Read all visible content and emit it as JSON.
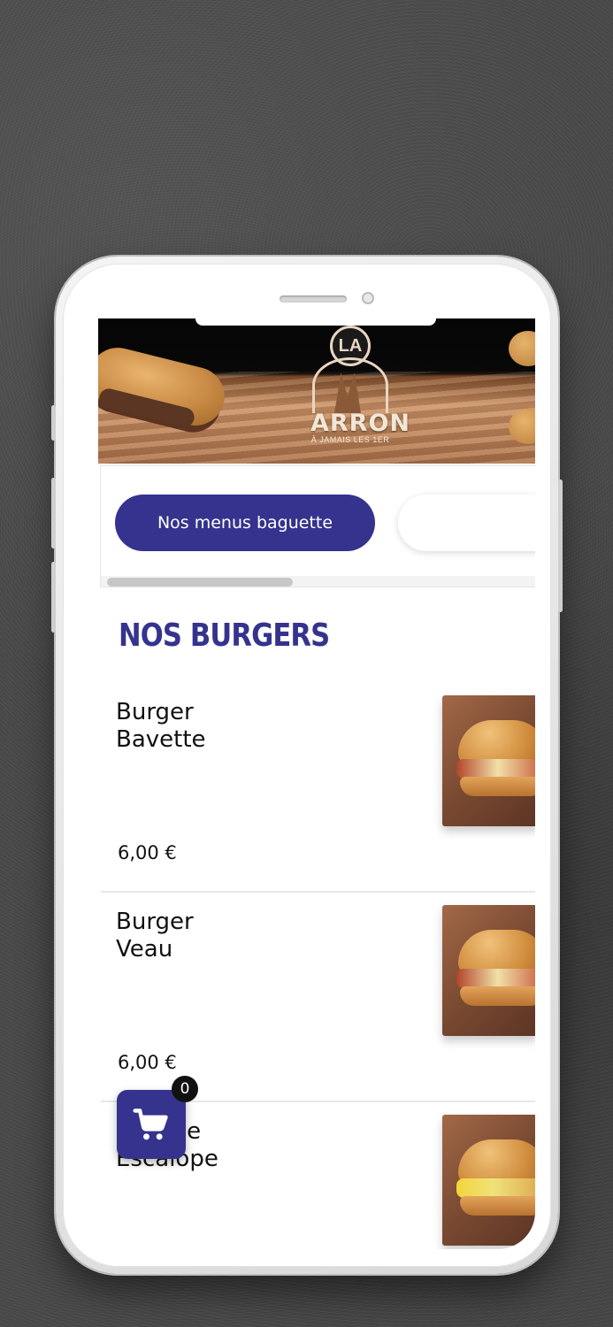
{
  "banner": {
    "logo_circle": "LA",
    "logo_name": "ARRON",
    "logo_tagline": "À JAMAIS LES 1ER"
  },
  "tabs": {
    "items": [
      {
        "label": "Nos menus baguette",
        "active": true
      },
      {
        "label": "",
        "active": false
      }
    ]
  },
  "section": {
    "title": "NOS BURGERS"
  },
  "items": [
    {
      "name": "Burger\nBavette",
      "price": "6,00 €"
    },
    {
      "name": "Burger\nVeau",
      "price": "6,00 €"
    },
    {
      "name": "Cheese\nEscalope",
      "price": ""
    }
  ],
  "cart": {
    "count": "0",
    "icon": "cart-icon"
  },
  "colors": {
    "accent": "#35338d",
    "background": "#4a4a4a"
  }
}
